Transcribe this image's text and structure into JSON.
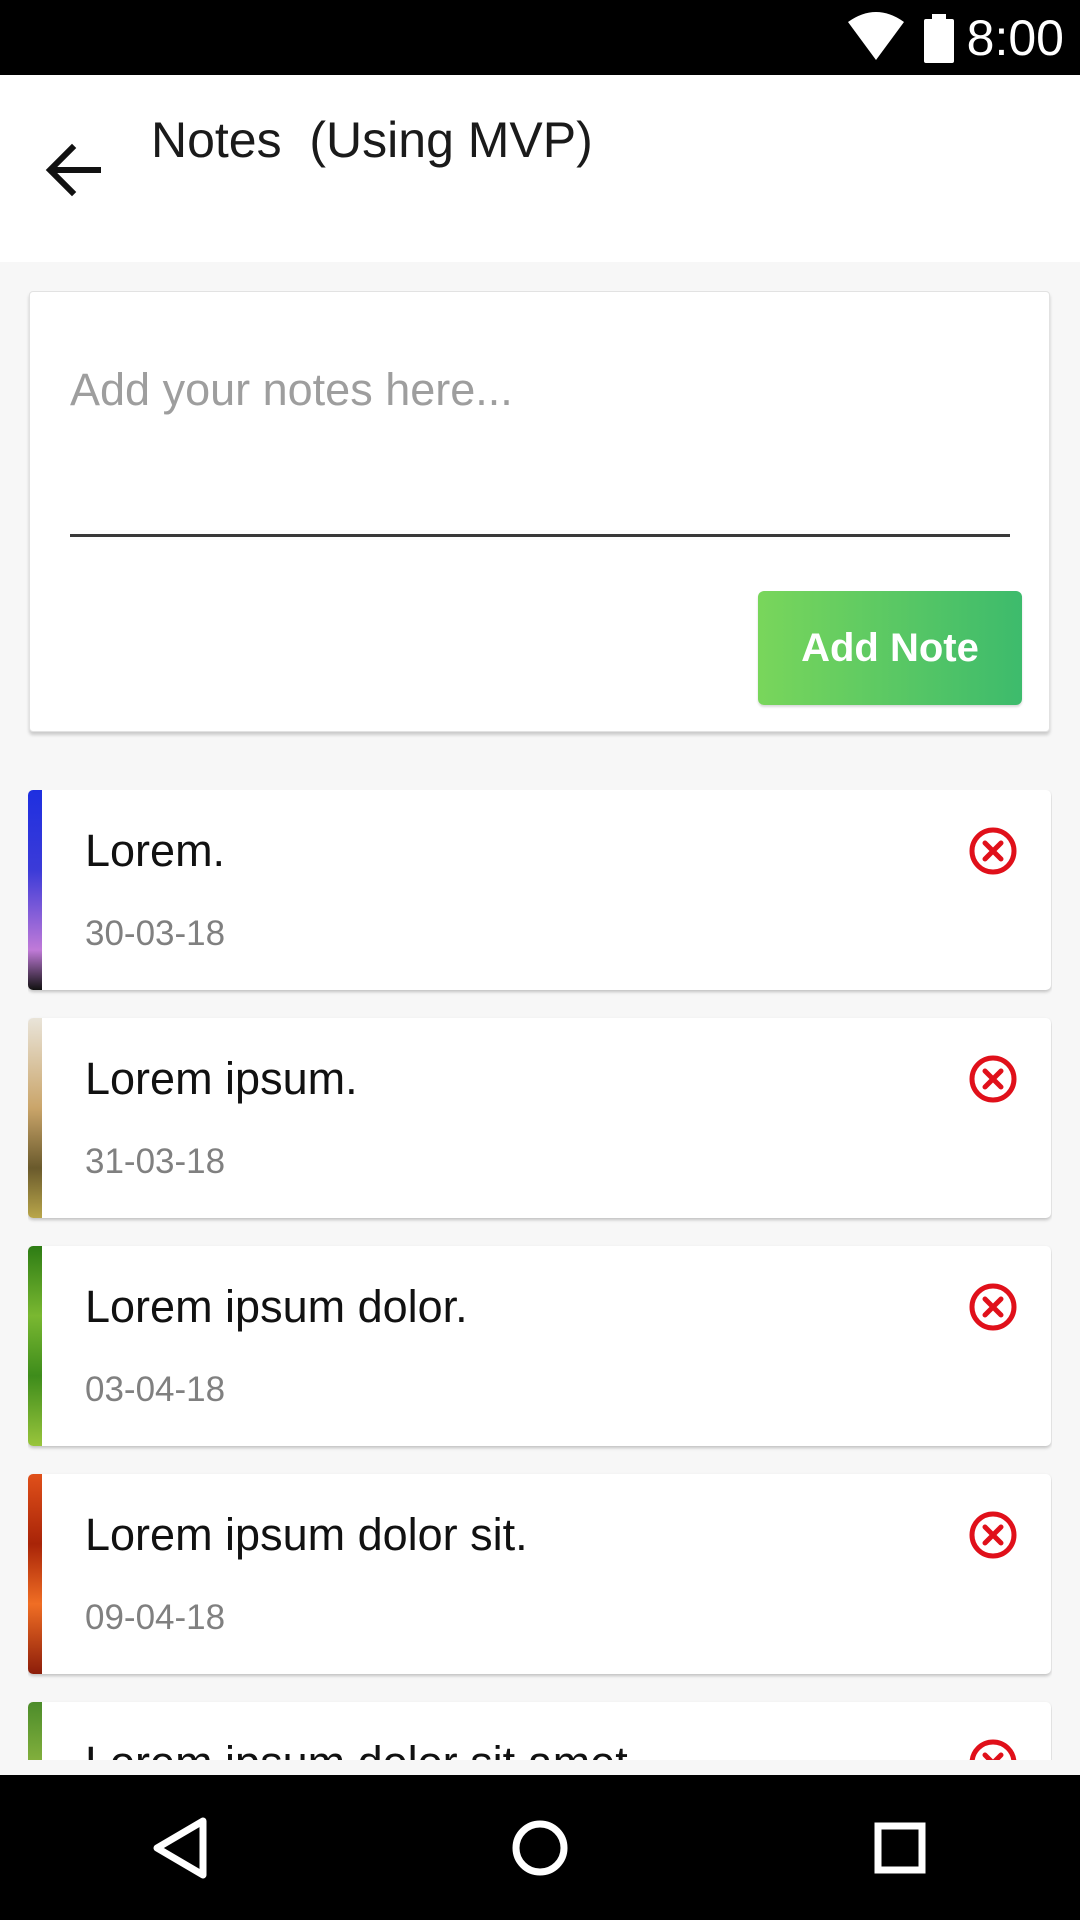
{
  "status_bar": {
    "time": "8:00",
    "icons": [
      "wifi-icon",
      "battery-icon"
    ]
  },
  "app_bar": {
    "title": "Notes  (Using MVP)",
    "back_icon": "back-arrow-icon"
  },
  "composer": {
    "placeholder": "Add your notes here...",
    "value": "",
    "add_button_label": "Add Note",
    "button_colors": [
      "#79d65b",
      "#3dbb6c"
    ]
  },
  "notes": [
    {
      "title": "Lorem.",
      "date": "30-03-18",
      "strip": "linear-gradient(180deg,#1e2fe0 0%,#3b3bd8 40%,#c07ad8 80%,#111 100%)"
    },
    {
      "title": "Lorem ipsum.",
      "date": "31-03-18",
      "strip": "linear-gradient(180deg,#e9e4d9 0%,#caa56a 45%,#6a5a2c 75%,#b9a64a 100%)"
    },
    {
      "title": "Lorem ipsum dolor.",
      "date": "03-04-18",
      "strip": "linear-gradient(180deg,#2d7c14 0%,#7ab831 35%,#3e8c1b 65%,#99c53c 100%)"
    },
    {
      "title": "Lorem ipsum dolor sit.",
      "date": "09-04-18",
      "strip": "linear-gradient(180deg,#e0501a 0%,#a82408 35%,#f06e24 65%,#8c1d0a 100%)"
    },
    {
      "title": "Lorem ipsum dolor sit amet.",
      "date": "",
      "strip": "linear-gradient(180deg,#4c8c2a 0%,#a8c84a 50%,#3b7020 100%)"
    }
  ],
  "delete_icon_color": "#e0101a",
  "nav_bar": {
    "buttons": [
      "back-triangle-icon",
      "home-circle-icon",
      "recents-square-icon"
    ]
  }
}
